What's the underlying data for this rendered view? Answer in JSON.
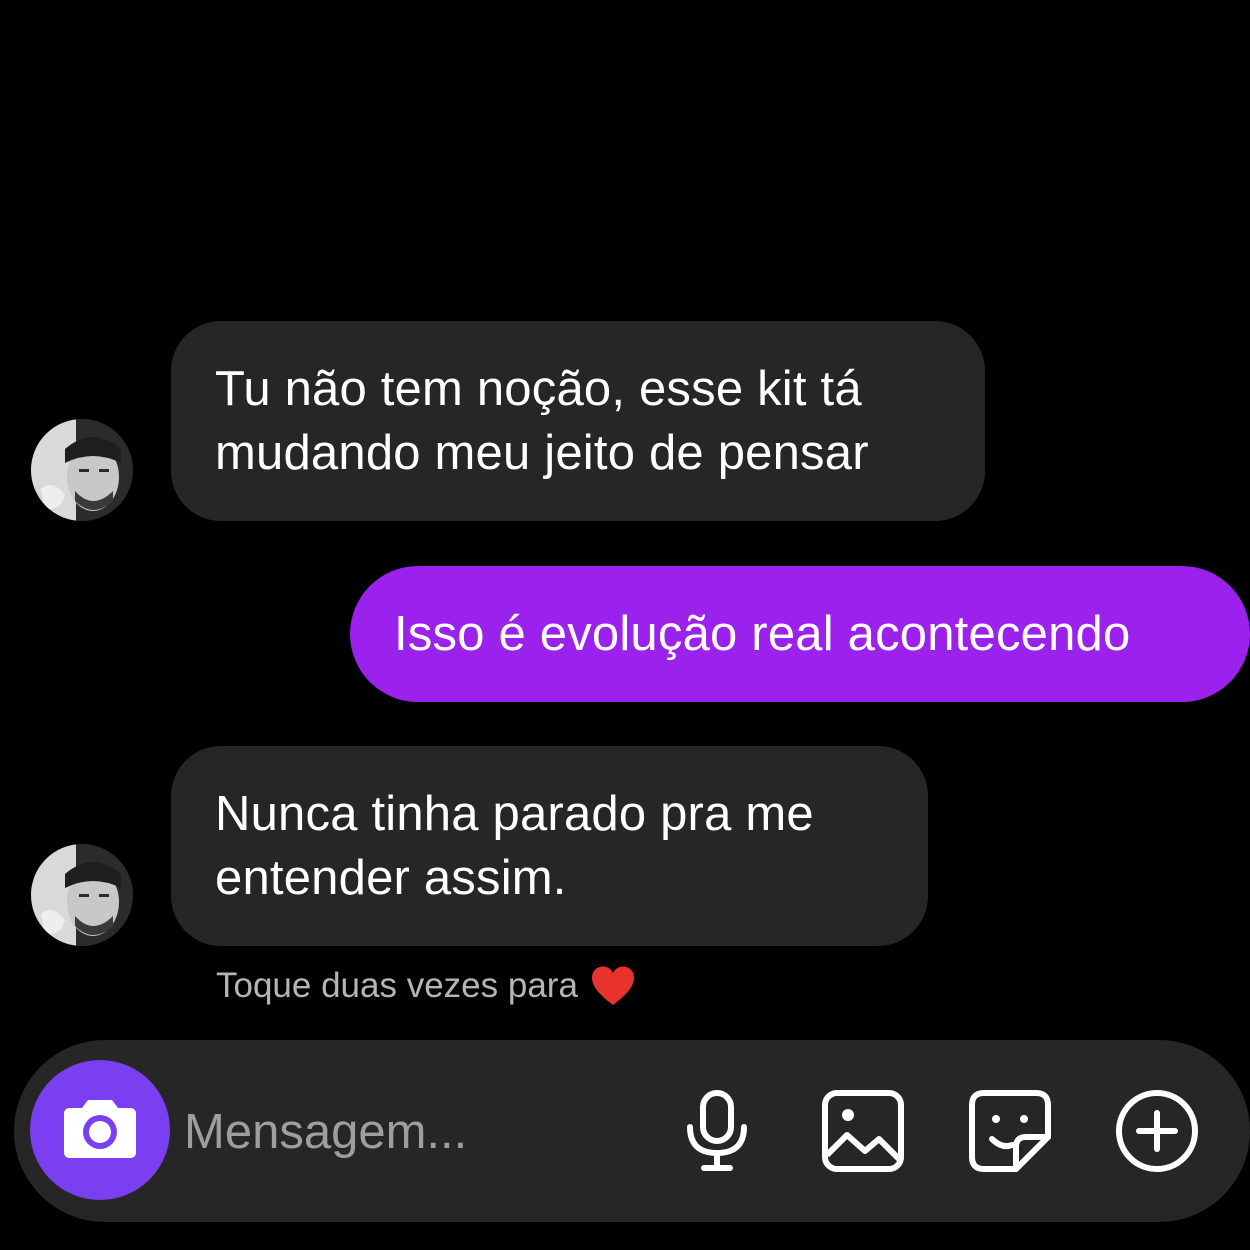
{
  "messages": [
    {
      "direction": "incoming",
      "lines": [
        "Tu não tem noção, esse kit tá",
        "mudando meu jeito de pensar"
      ]
    },
    {
      "direction": "outgoing",
      "lines": [
        "Isso é evolução real acontecendo"
      ]
    },
    {
      "direction": "incoming",
      "lines": [
        "Nunca tinha parado pra me",
        "entender assim."
      ]
    }
  ],
  "hint": {
    "text": "Toque duas vezes para",
    "icon": "heart-icon"
  },
  "composer": {
    "placeholder": "Mensagem...",
    "icons": [
      "camera-icon",
      "microphone-icon",
      "gallery-icon",
      "sticker-icon",
      "plus-icon"
    ]
  },
  "colors": {
    "background": "#000000",
    "incoming_bubble": "#262626",
    "outgoing_bubble": "#9b22ec",
    "camera_button": "#7b3ff2",
    "heart": "#e8322e"
  }
}
